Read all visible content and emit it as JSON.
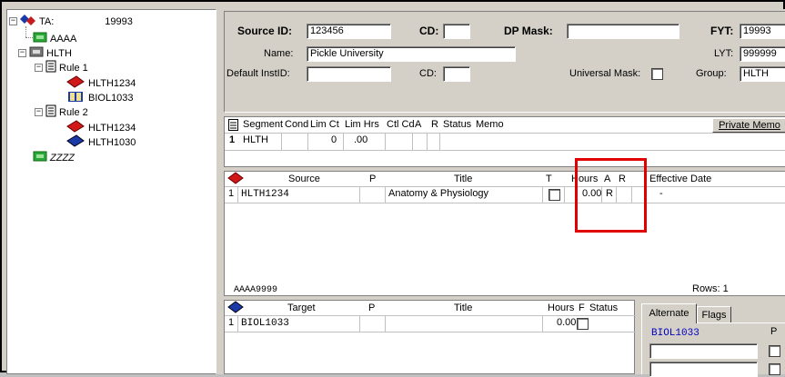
{
  "tree": {
    "root": {
      "label": "TA:",
      "value": "19993",
      "expander": "−"
    },
    "nodes": [
      {
        "label": "AAAA"
      },
      {
        "label": "HLTH",
        "expander": "−"
      },
      {
        "label": "Rule 1",
        "expander": "−"
      },
      {
        "label": "HLTH1234"
      },
      {
        "label": "BIOL1033"
      },
      {
        "label": "Rule 2",
        "expander": "−"
      },
      {
        "label": "HLTH1234"
      },
      {
        "label": "HLTH1030"
      },
      {
        "label": "ZZZZ"
      }
    ]
  },
  "header": {
    "source_id_label": "Source ID:",
    "source_id_value": "123456",
    "cd_label": "CD:",
    "dp_mask_label": "DP Mask:",
    "fyt_label": "FYT:",
    "fyt_value": "19993",
    "name_label": "Name:",
    "name_value": "Pickle University",
    "lyt_label": "LYT:",
    "lyt_value": "999999",
    "default_instid_label": "Default InstID:",
    "cd2_label": "CD:",
    "universal_mask_label": "Universal Mask:",
    "group_label": "Group:",
    "group_value": "HLTH"
  },
  "segment": {
    "headers": [
      "Segment",
      "Cond",
      "Lim Ct",
      "Lim Hrs",
      "Ctl Cd",
      "A",
      "R",
      "Status",
      "Memo"
    ],
    "private_memo_label": "Private Memo",
    "row": {
      "num": "1",
      "segment": "HLTH",
      "lim_ct": "0",
      "lim_hrs": ".00"
    }
  },
  "source_grid": {
    "headers": {
      "source": "Source",
      "p": "P",
      "title": "Title",
      "t": "T",
      "hours": "Hours",
      "a": "A",
      "r": "R",
      "effective": "Effective Date"
    },
    "row": {
      "num": "1",
      "source": "HLTH1234",
      "title": "Anatomy & Physiology",
      "hours": "0.00",
      "a": "R",
      "effective": "-"
    },
    "footer_left": "AAAA9999",
    "footer_right": "Rows: 1"
  },
  "target_grid": {
    "headers": {
      "target": "Target",
      "p": "P",
      "title": "Title",
      "hours": "Hours",
      "f": "F",
      "status": "Status"
    },
    "row": {
      "num": "1",
      "target": "BIOL1033",
      "hours": "0.00"
    }
  },
  "alternate": {
    "tabs": [
      "Alternate",
      "Flags"
    ],
    "value": "BIOL1033",
    "p_label": "P"
  },
  "colors": {
    "highlight": "#e00000",
    "link_blue": "#0000c0"
  }
}
